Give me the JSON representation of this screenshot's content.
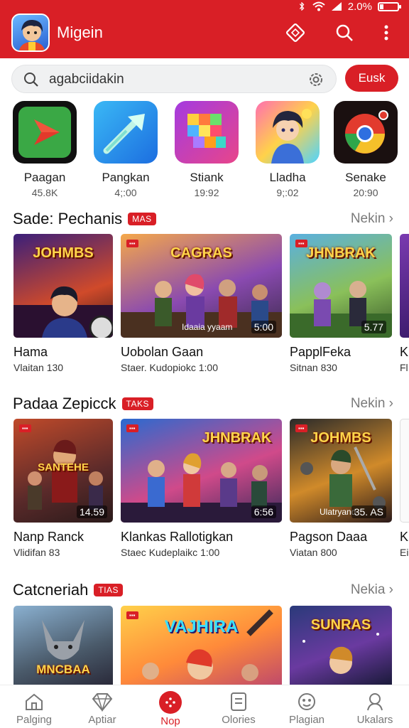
{
  "status_bar": {
    "battery": "2.0%",
    "battery_level": 0.2
  },
  "header": {
    "title": "Migein",
    "icons": [
      "diamond-icon",
      "search-icon",
      "more-vert-icon"
    ]
  },
  "search": {
    "query": "agabciidakin",
    "button_label": "Eusk"
  },
  "top_apps": [
    {
      "name": "Paagan",
      "count": "45.8K",
      "icon": "play-arrow-icon"
    },
    {
      "name": "Pangkan",
      "count": "4;:00",
      "icon": "arrow-icon"
    },
    {
      "name": "Stiank",
      "count": "19:92",
      "icon": "blocks-icon"
    },
    {
      "name": "Lladha",
      "count": "9;:02",
      "icon": "character-icon"
    },
    {
      "name": "Senake",
      "count": "20:90",
      "icon": "browser-icon"
    }
  ],
  "sections": [
    {
      "title": "Sade: Pechanis",
      "badge": "MAS",
      "more": "Nekin",
      "cards": [
        {
          "title": "Hama",
          "sub": "Vlaitan 130",
          "thumb_title": "JOHMBS",
          "duration": ""
        },
        {
          "title": "Uobolan Gaan",
          "sub": "Staer. Kudopiokc 1:00",
          "thumb_title": "CAGRAS",
          "overlay": "Idaaia yyaam",
          "duration": "5:00"
        },
        {
          "title": "PapplFeka",
          "sub": "Sitnan 830",
          "thumb_title": "JHNBRAK",
          "duration": "5.77"
        },
        {
          "title": "K",
          "sub": "Fl",
          "thumb_title": "",
          "duration": ""
        }
      ]
    },
    {
      "title": "Padaa Zepicck",
      "badge": "TAKS",
      "more": "Nekin",
      "cards": [
        {
          "title": "Nanp Ranck",
          "sub": "Vlidifan 83",
          "thumb_title": "SANTEHE",
          "duration": "14.59"
        },
        {
          "title": "Klankas Rallotigkan",
          "sub": "Staec Kudeplaikc 1:00",
          "thumb_title": "JHNBRAK",
          "duration": "6:56"
        },
        {
          "title": "Pagson Daaa",
          "sub": "Viatan 800",
          "thumb_title": "JOHMBS",
          "overlay": "Ulatryand",
          "duration": "35. AS"
        },
        {
          "title": "K",
          "sub": "Ei",
          "thumb_title": "",
          "duration": ""
        }
      ]
    },
    {
      "title": "Catcneriah",
      "badge": "TIAS",
      "more": "Nekia",
      "cards": [
        {
          "title": "",
          "sub": "",
          "thumb_title": "MNCBAA",
          "duration": ""
        },
        {
          "title": "",
          "sub": "",
          "thumb_title": "VAJHIRA",
          "duration": ""
        },
        {
          "title": "",
          "sub": "",
          "thumb_title": "SUNRAS",
          "duration": ""
        }
      ]
    }
  ],
  "bottom_nav": [
    {
      "label": "Palging",
      "icon": "home-icon",
      "active": false
    },
    {
      "label": "Aptiar",
      "icon": "diamond-icon",
      "active": false
    },
    {
      "label": "Nop",
      "icon": "gamepad-icon",
      "active": true
    },
    {
      "label": "Olories",
      "icon": "document-icon",
      "active": false
    },
    {
      "label": "Plagian",
      "icon": "controller-icon",
      "active": false
    },
    {
      "label": "Ukalars",
      "icon": "profile-icon",
      "active": false
    }
  ],
  "colors": {
    "brand": "#d91f26",
    "text": "#111111",
    "muted": "#7a7a7a"
  }
}
